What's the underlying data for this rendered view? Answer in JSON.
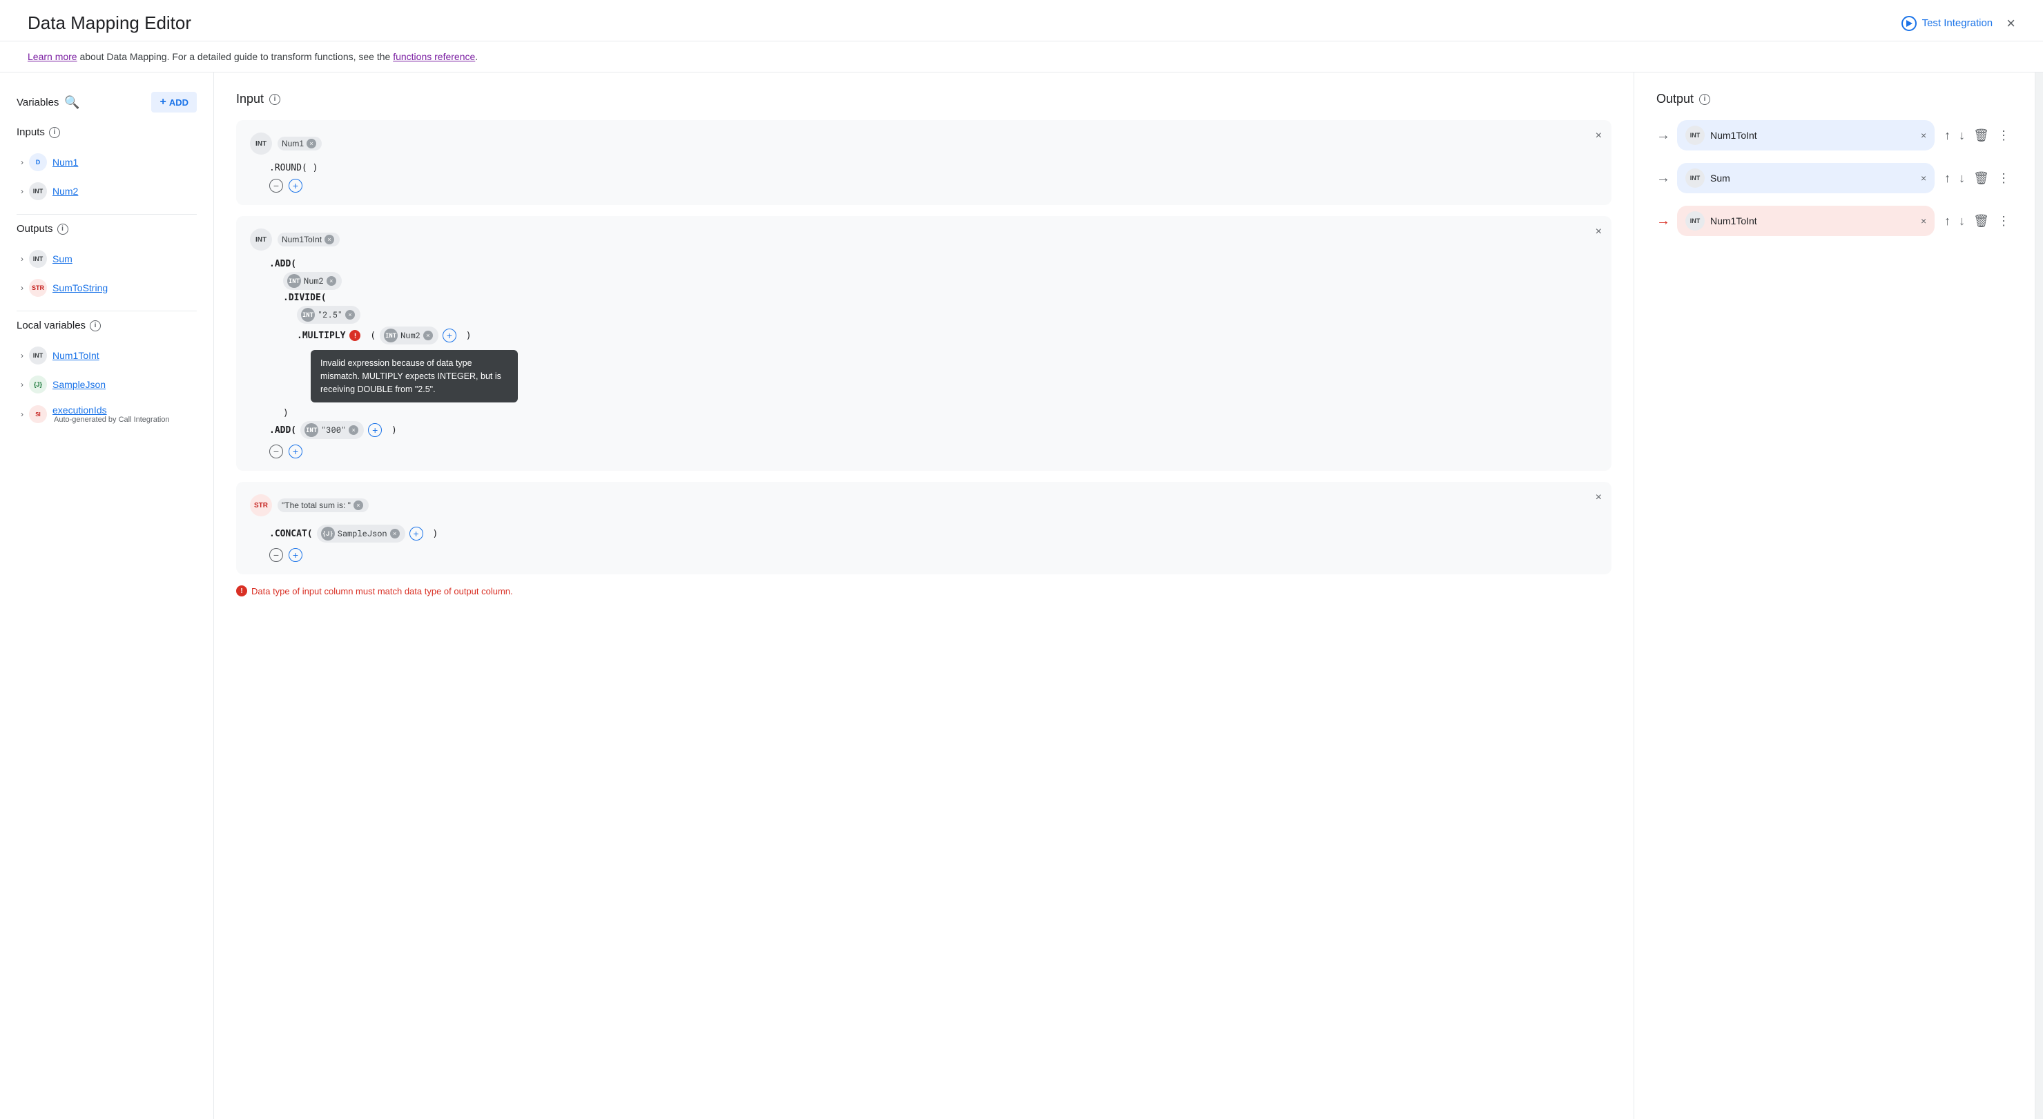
{
  "header": {
    "title": "Data Mapping Editor",
    "test_integration_label": "Test Integration",
    "close_label": "×"
  },
  "info_bar": {
    "text_before": "Learn more",
    "text_middle": " about Data Mapping. For a detailed guide to transform functions, see the ",
    "link_label": "functions reference",
    "text_after": "."
  },
  "sidebar": {
    "variables_label": "Variables",
    "inputs_label": "Inputs",
    "outputs_label": "Outputs",
    "local_variables_label": "Local variables",
    "add_label": "ADD",
    "items": {
      "inputs": [
        {
          "name": "Num1",
          "type": "D"
        },
        {
          "name": "Num2",
          "type": "INT"
        }
      ],
      "outputs": [
        {
          "name": "Sum",
          "type": "INT"
        },
        {
          "name": "SumToString",
          "type": "STR"
        }
      ],
      "local_variables": [
        {
          "name": "Num1ToInt",
          "type": "INT"
        },
        {
          "name": "SampleJson",
          "type": "J"
        },
        {
          "name": "executionIds",
          "type": "SI",
          "sub": "Auto-generated by Call Integration"
        }
      ]
    }
  },
  "input_panel": {
    "label": "Input",
    "cards": [
      {
        "id": "card1",
        "variable": "Num1",
        "type": "INT",
        "lines": [
          {
            "text": ".ROUND(  )",
            "indent": 0
          }
        ]
      },
      {
        "id": "card2",
        "variable": "Num1ToInt",
        "type": "INT",
        "lines": [
          {
            "text": ".ADD(",
            "indent": 0
          },
          {
            "type": "tag",
            "badge_type": "INT",
            "badge_name": "Num2",
            "indent": 1
          },
          {
            "text": ".DIVIDE(",
            "indent": 1
          },
          {
            "type": "tag",
            "badge_type": "INT",
            "badge_name": "\"2.5\"",
            "indent": 2
          },
          {
            "text": ".MULTIPLY",
            "error": true,
            "indent": 2,
            "extra": "( INT Num2 + )"
          }
        ],
        "tooltip": "Invalid expression because of data type mismatch. MULTIPLY expects INTEGER, but is receiving DOUBLE from \"2.5\".",
        "extra_lines": [
          {
            "text": ")",
            "indent": 1
          },
          {
            "text": ".ADD(  INT  \"300\"  +  )",
            "indent": 0
          }
        ]
      },
      {
        "id": "card3",
        "variable": "\"The total sum is: \"",
        "type": "STR",
        "lines": [
          {
            "text": ".CONCAT(  J  SampleJson  ×  +  )",
            "indent": 0
          }
        ]
      }
    ]
  },
  "output_panel": {
    "label": "Output",
    "rows": [
      {
        "arrow": "→",
        "arrow_color": "gray",
        "name": "Num1ToInt",
        "type": "INT"
      },
      {
        "arrow": "→",
        "arrow_color": "gray",
        "name": "Sum",
        "type": "INT"
      },
      {
        "arrow": "→",
        "arrow_color": "red",
        "name": "Num1ToInt",
        "type": "INT"
      }
    ]
  },
  "error": {
    "tooltip_text": "Invalid expression because of data type mismatch. MULTIPLY expects INTEGER, but is receiving DOUBLE from \"2.5\".",
    "bottom_error": "Data type of input column must match data type of output column."
  },
  "icons": {
    "search": "🔍",
    "info": "i",
    "play": "▶",
    "close": "×",
    "chevron_right": "›",
    "up_arrow": "↑",
    "down_arrow": "↓",
    "trash": "🗑",
    "more": "⋮",
    "plus": "+",
    "minus": "−",
    "x_close": "×"
  }
}
